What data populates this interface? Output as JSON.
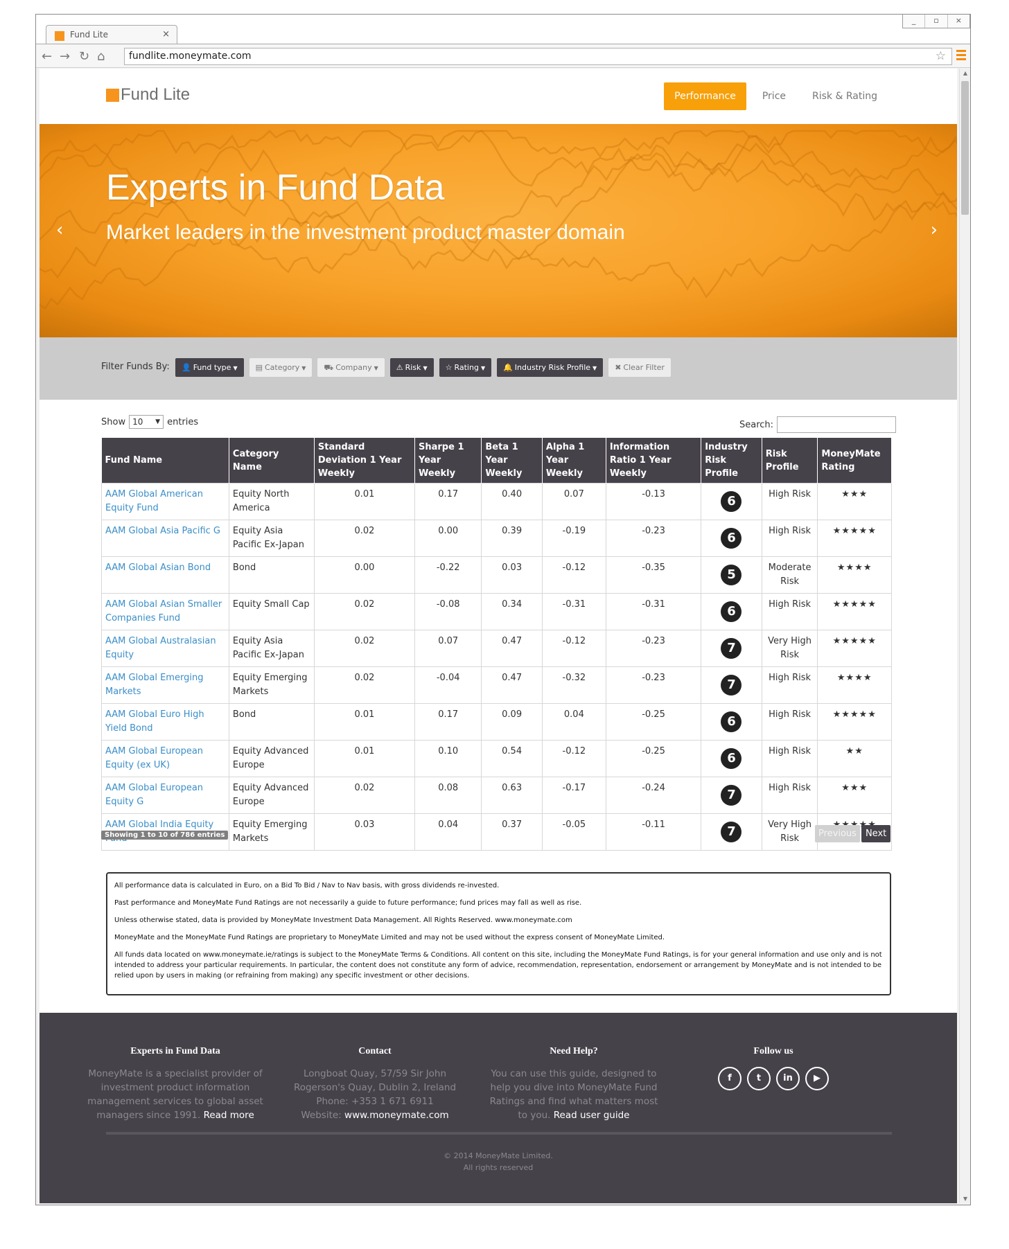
{
  "browser": {
    "tab_title": "Fund Lite",
    "tab_close": "×",
    "url": "fundlite.moneymate.com",
    "window_controls": [
      "_",
      "▫",
      "×"
    ],
    "nav_icons": {
      "back": "←",
      "forward": "→",
      "reload": "↻",
      "home": "⌂",
      "bookmark_star": "☆"
    }
  },
  "site": {
    "brand": "Fund Lite",
    "accent_color": "#f7941d",
    "nav": [
      {
        "label": "Performance",
        "active": true
      },
      {
        "label": "Price",
        "active": false
      },
      {
        "label": "Risk & Rating",
        "active": false
      }
    ]
  },
  "hero": {
    "title": "Experts in Fund Data",
    "subtitle": "Market leaders in the investment product master domain",
    "prev_arrow": "‹",
    "next_arrow": "›"
  },
  "filter": {
    "label": "Filter Funds By:",
    "buttons": [
      {
        "icon": "👤",
        "icon_name": "user-icon",
        "label": "Fund type",
        "style": "dark"
      },
      {
        "icon": "▤",
        "icon_name": "list-icon",
        "label": "Category",
        "style": "light"
      },
      {
        "icon": "⛟",
        "icon_name": "briefcase-icon",
        "label": "Company",
        "style": "light"
      },
      {
        "icon": "⚠",
        "icon_name": "warning-icon",
        "label": "Risk",
        "style": "dark"
      },
      {
        "icon": "☆",
        "icon_name": "star-icon",
        "label": "Rating",
        "style": "dark"
      },
      {
        "icon": "🔔",
        "icon_name": "bell-icon",
        "label": "Industry Risk Profile",
        "style": "dark"
      },
      {
        "icon": "✖",
        "icon_name": "close-icon",
        "label": "Clear Filter",
        "style": "light"
      }
    ]
  },
  "table_controls": {
    "show_prefix": "Show",
    "page_size": "10",
    "show_suffix": "entries",
    "search_label": "Search:"
  },
  "table": {
    "headers": [
      "Fund Name",
      "Category Name",
      "Standard Deviation 1 Year Weekly",
      "Sharpe 1 Year Weekly",
      "Beta 1 Year Weekly",
      "Alpha 1 Year Weekly",
      "Information Ratio 1 Year Weekly",
      "Industry Risk Profile",
      "Risk Profile",
      "MoneyMate Rating"
    ],
    "rows": [
      {
        "fund": "AAM Global American Equity Fund",
        "category": "Equity North America",
        "sd": "0.01",
        "sharpe": "0.17",
        "beta": "0.40",
        "alpha": "0.07",
        "ir": "-0.13",
        "irp": "6",
        "risk": "High Risk",
        "rating": 3
      },
      {
        "fund": "AAM Global Asia Pacific G",
        "category": "Equity Asia Pacific Ex-Japan",
        "sd": "0.02",
        "sharpe": "0.00",
        "beta": "0.39",
        "alpha": "-0.19",
        "ir": "-0.23",
        "irp": "6",
        "risk": "High Risk",
        "rating": 5
      },
      {
        "fund": "AAM Global Asian Bond",
        "category": "Bond",
        "sd": "0.00",
        "sharpe": "-0.22",
        "beta": "0.03",
        "alpha": "-0.12",
        "ir": "-0.35",
        "irp": "5",
        "risk": "Moderate Risk",
        "rating": 4
      },
      {
        "fund": "AAM Global Asian Smaller Companies Fund",
        "category": "Equity Small Cap",
        "sd": "0.02",
        "sharpe": "-0.08",
        "beta": "0.34",
        "alpha": "-0.31",
        "ir": "-0.31",
        "irp": "6",
        "risk": "High Risk",
        "rating": 5
      },
      {
        "fund": "AAM Global Australasian Equity",
        "category": "Equity Asia Pacific Ex-Japan",
        "sd": "0.02",
        "sharpe": "0.07",
        "beta": "0.47",
        "alpha": "-0.12",
        "ir": "-0.23",
        "irp": "7",
        "risk": "Very High Risk",
        "rating": 5
      },
      {
        "fund": "AAM Global Emerging Markets",
        "category": "Equity Emerging Markets",
        "sd": "0.02",
        "sharpe": "-0.04",
        "beta": "0.47",
        "alpha": "-0.32",
        "ir": "-0.23",
        "irp": "7",
        "risk": "High Risk",
        "rating": 4
      },
      {
        "fund": "AAM Global Euro High Yield Bond",
        "category": "Bond",
        "sd": "0.01",
        "sharpe": "0.17",
        "beta": "0.09",
        "alpha": "0.04",
        "ir": "-0.25",
        "irp": "6",
        "risk": "High Risk",
        "rating": 5
      },
      {
        "fund": "AAM Global European Equity (ex UK)",
        "category": "Equity Advanced Europe",
        "sd": "0.01",
        "sharpe": "0.10",
        "beta": "0.54",
        "alpha": "-0.12",
        "ir": "-0.25",
        "irp": "6",
        "risk": "High Risk",
        "rating": 2
      },
      {
        "fund": "AAM Global European Equity G",
        "category": "Equity Advanced Europe",
        "sd": "0.02",
        "sharpe": "0.08",
        "beta": "0.63",
        "alpha": "-0.17",
        "ir": "-0.24",
        "irp": "7",
        "risk": "High Risk",
        "rating": 3
      },
      {
        "fund": "AAM Global India Equity Fund",
        "category": "Equity Emerging Markets",
        "sd": "0.03",
        "sharpe": "0.04",
        "beta": "0.37",
        "alpha": "-0.05",
        "ir": "-0.11",
        "irp": "7",
        "risk": "Very High Risk",
        "rating": 5
      }
    ]
  },
  "pagination": {
    "info": "Showing 1 to 10 of 786 entries",
    "previous": "Previous",
    "next": "Next"
  },
  "disclaimer": [
    "All performance data is calculated in Euro, on a Bid To Bid / Nav to Nav basis, with gross dividends re-invested.",
    "Past performance and MoneyMate Fund Ratings are not necessarily a guide to future performance; fund prices may fall as well as rise.",
    "Unless otherwise stated, data is provided by MoneyMate Investment Data Management. All Rights Reserved. www.moneymate.com",
    "MoneyMate and the MoneyMate Fund Ratings are proprietary to MoneyMate Limited and may not be used without the express consent of MoneyMate Limited.",
    "All funds data located on www.moneymate.ie/ratings is subject to the MoneyMate Terms & Conditions. All content on this site, including the MoneyMate Fund Ratings, is for your general information and use only and is not intended to address your particular requirements. In particular, the content does not constitute any form of advice, recommendation, representation, endorsement or arrangement by MoneyMate and is not intended to be relied upon by users in making (or refraining from making) any specific investment or other decisions."
  ],
  "footer": {
    "about": {
      "title": "Experts in Fund Data",
      "text": "MoneyMate is a specialist provider of investment product information management services to global asset managers since 1991.",
      "link": "Read more"
    },
    "contact": {
      "title": "Contact",
      "line1": "Longboat Quay, 57/59 Sir John Rogerson's Quay, Dublin 2, Ireland",
      "phone": "Phone: +353 1 671 6911",
      "website_label": "Website:",
      "website": "www.moneymate.com"
    },
    "help": {
      "title": "Need Help?",
      "text": "You can use this guide, designed to help you dive into MoneyMate Fund Ratings and find what matters most to you.",
      "link": "Read user guide"
    },
    "follow": {
      "title": "Follow us",
      "icons": [
        {
          "glyph": "f",
          "name": "facebook-icon"
        },
        {
          "glyph": "t",
          "name": "twitter-icon"
        },
        {
          "glyph": "in",
          "name": "linkedin-icon"
        },
        {
          "glyph": "▶",
          "name": "youtube-icon"
        }
      ]
    },
    "copyright": "© 2014 MoneyMate Limited.",
    "rights": "All rights reserved"
  }
}
